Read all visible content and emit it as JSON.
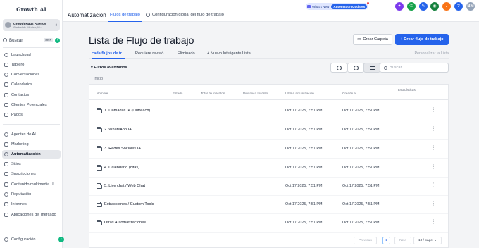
{
  "brand": "Growth AI",
  "agency": {
    "name": "Growth Haus Agency",
    "location": "Ciudad de México, M..."
  },
  "sidebar_search": {
    "placeholder": "Buscar",
    "shortcut": "ctrl K"
  },
  "nav": {
    "items": [
      {
        "label": "Launchpad"
      },
      {
        "label": "Tablero"
      },
      {
        "label": "Conversaciones"
      },
      {
        "label": "Calendarios"
      },
      {
        "label": "Contactos"
      },
      {
        "label": "Clientes Potenciales"
      },
      {
        "label": "Pagos"
      },
      {
        "label": "Agentes de AI"
      },
      {
        "label": "Marketing"
      },
      {
        "label": "Automatización"
      },
      {
        "label": "Sitios"
      },
      {
        "label": "Suscripciones"
      },
      {
        "label": "Contenido multimedia U..."
      },
      {
        "label": "Reputación"
      },
      {
        "label": "Informes"
      },
      {
        "label": "Aplicaciones del mercado"
      }
    ],
    "settings": "Configuración"
  },
  "header": {
    "section": "Automatización",
    "tabs": [
      "Flujos de trabajo",
      "Configuración global del flujo de trabajo"
    ],
    "whats_new": "What's New",
    "automation_updates": "Automation Updates",
    "avatar": "BM"
  },
  "page": {
    "title": "Lista de Flujo de trabajo",
    "create_folder": "Crear Carpeta",
    "create_workflow": "+ Crear flujo de trabajo",
    "subtabs": [
      "cada flujos de tr...",
      "Requiere revisió...",
      "Eliminado",
      "+ Nuevo Inteligente Lista"
    ],
    "customize": "Personalizar la Lista",
    "filters": "Filtros avanzados",
    "search_placeholder": "Buscar",
    "breadcrumb": "Inicio"
  },
  "table": {
    "columns": [
      "Nombre",
      "Estado",
      "Total de inscritos",
      "Dinámico Inscrito",
      "Última actualización",
      "Creado el",
      "Estadísticas"
    ],
    "rows": [
      {
        "name": "1. Llamadas IA (Outreach)",
        "updated": "Oct 17 2025, 7:51 PM",
        "created": "Oct 17 2025, 7:51 PM"
      },
      {
        "name": "2. WhatsApp IA",
        "updated": "Oct 17 2025, 7:51 PM",
        "created": "Oct 17 2025, 7:51 PM"
      },
      {
        "name": "3. Redes Sociales IA",
        "updated": "Oct 17 2025, 7:51 PM",
        "created": "Oct 17 2025, 7:51 PM"
      },
      {
        "name": "4. Calendario (citas)",
        "updated": "Oct 17 2025, 7:51 PM",
        "created": "Oct 17 2025, 7:51 PM"
      },
      {
        "name": "5. Live chat / Web Chat",
        "updated": "Oct 17 2025, 7:51 PM",
        "created": "Oct 17 2025, 7:51 PM"
      },
      {
        "name": "Extracciones / Custom Tools",
        "updated": "Oct 17 2025, 7:51 PM",
        "created": "Oct 17 2025, 7:51 PM"
      },
      {
        "name": "Otras Automatizaciones",
        "updated": "Oct 17 2025, 7:51 PM",
        "created": "Oct 17 2025, 7:51 PM"
      }
    ]
  },
  "pagination": {
    "previous": "Previous",
    "page": "1",
    "next": "Next",
    "per_page": "10 / page"
  },
  "colors": {
    "primary": "#2563eb",
    "sidebar_active": "#e5e7eb",
    "green": "#10b981"
  }
}
